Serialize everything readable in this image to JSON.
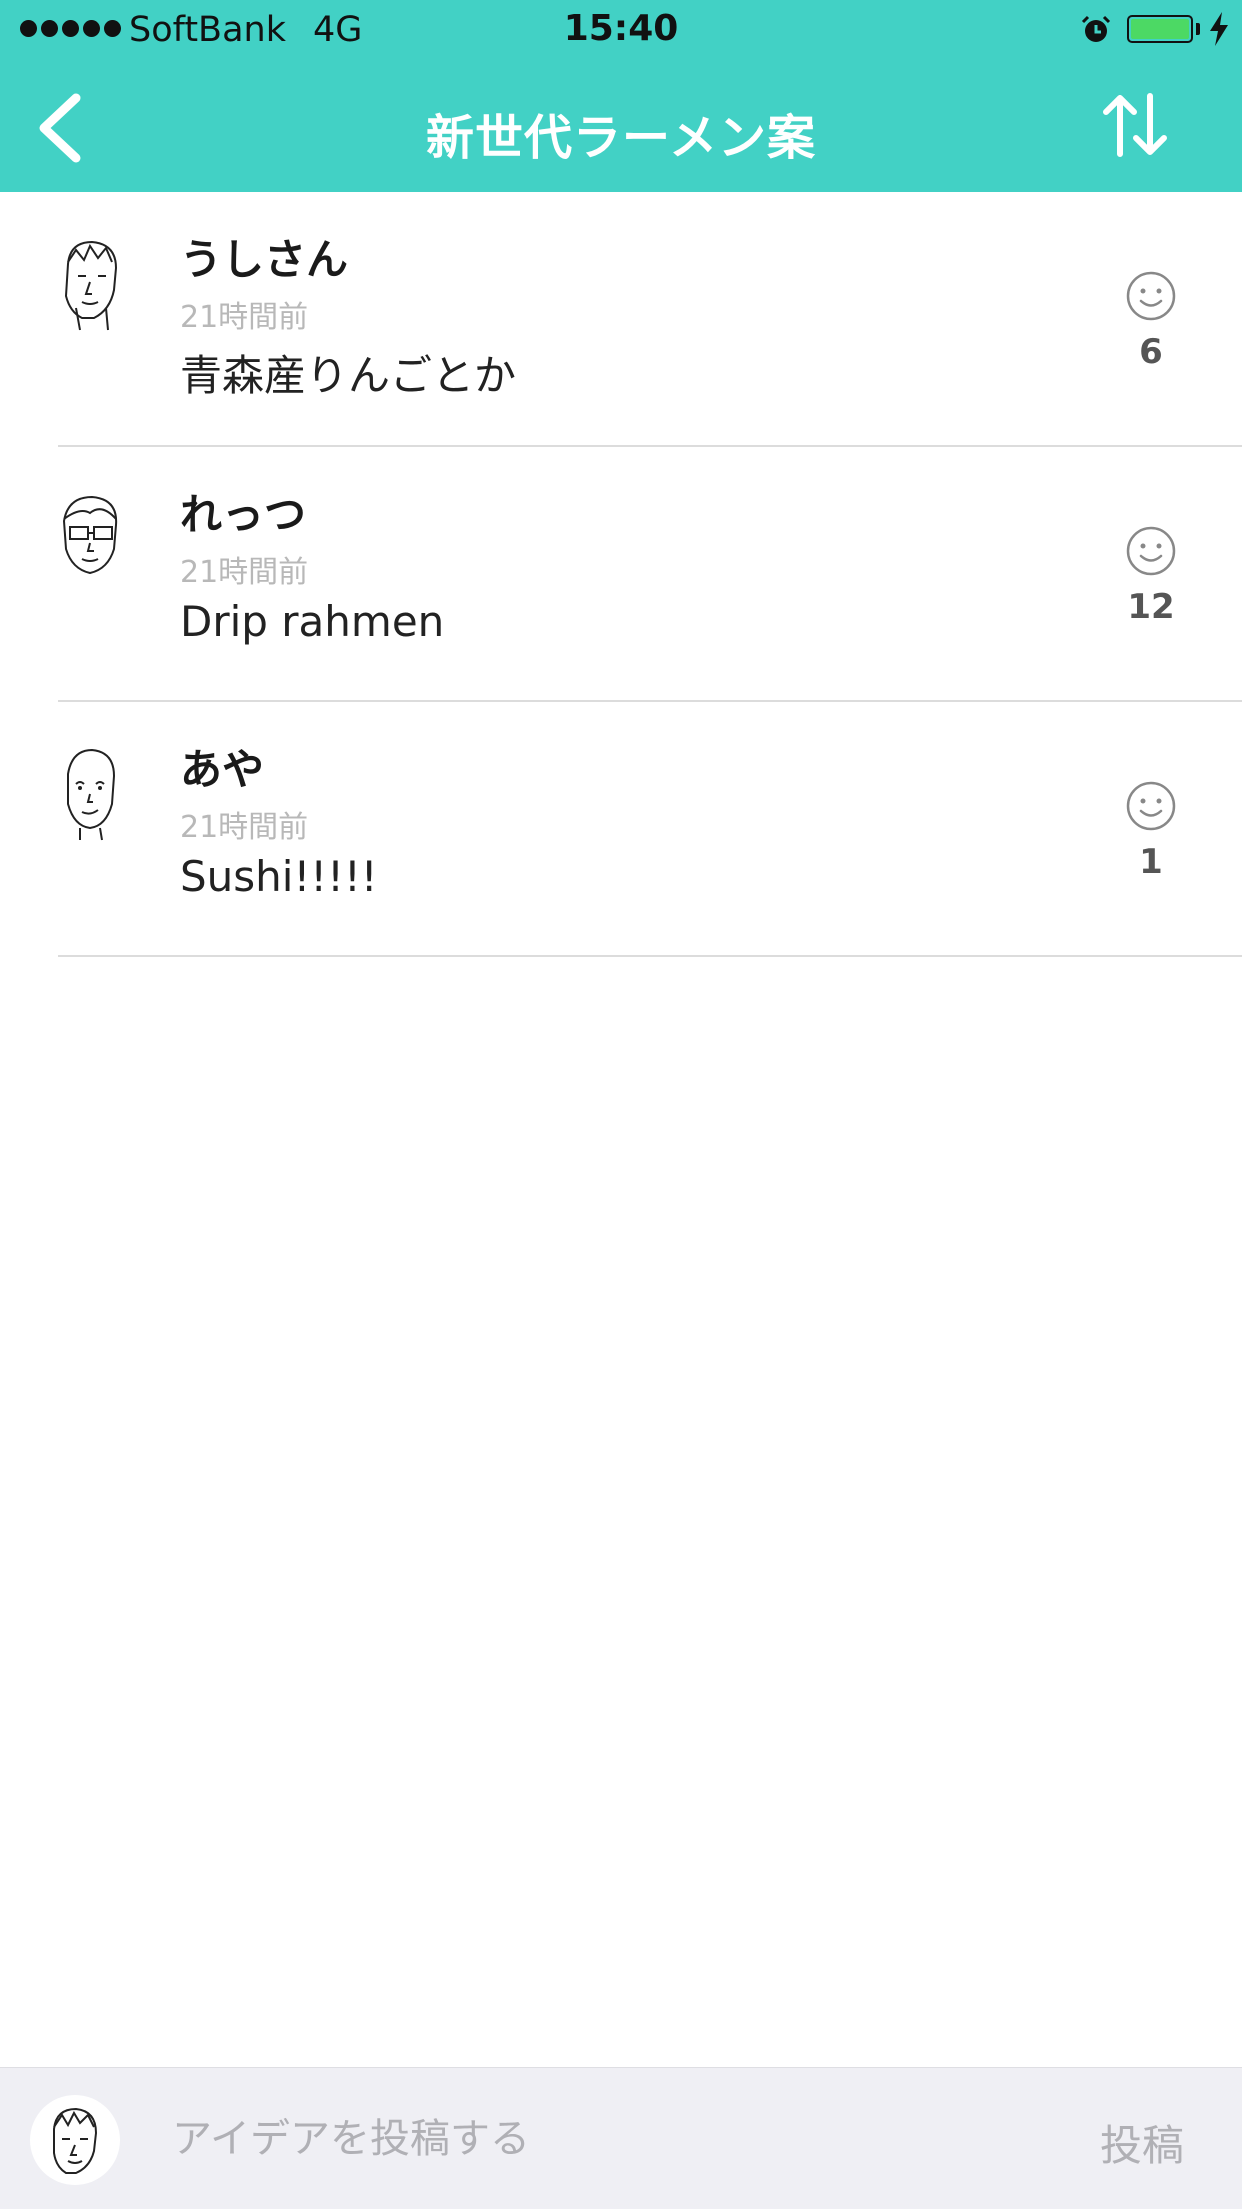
{
  "colors": {
    "accent": "#42d1c5",
    "like_icon": "#888888"
  },
  "status_bar": {
    "carrier": "SoftBank",
    "network": "4G",
    "time": "15:40"
  },
  "nav": {
    "title": "新世代ラーメン案",
    "back_icon": "chevron-left-icon",
    "sort_icon": "sort-arrows-icon"
  },
  "posts": [
    {
      "author": "うしさん",
      "time": "21時間前",
      "text": "青森産りんごとか",
      "likes": "6",
      "like_icon": "smiley-icon"
    },
    {
      "author": "れっつ",
      "time": "21時間前",
      "text": "Drip rahmen",
      "likes": "12",
      "like_icon": "smiley-icon"
    },
    {
      "author": "あや",
      "time": "21時間前",
      "text": "Sushi!!!!!",
      "likes": "1",
      "like_icon": "smiley-icon"
    }
  ],
  "composer": {
    "placeholder": "アイデアを投稿する",
    "post_label": "投稿"
  }
}
